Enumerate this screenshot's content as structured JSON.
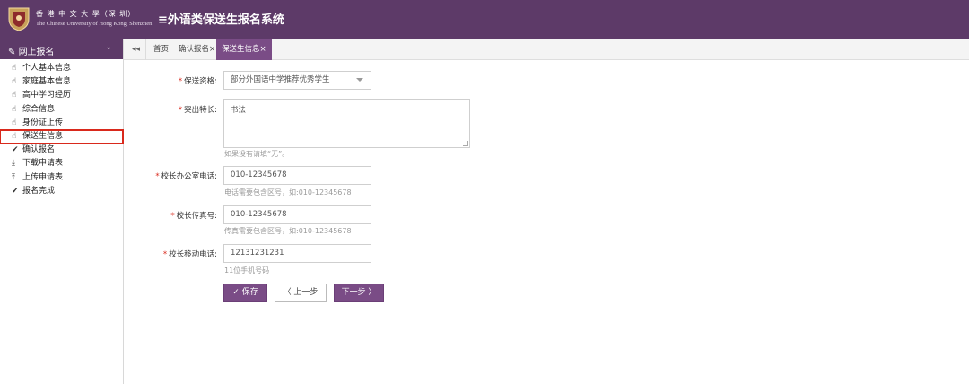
{
  "header": {
    "university_cn": "香 港 中 文 大 學（深 圳）",
    "university_en": "The Chinese University of Hong Kong, Shenzhen",
    "system_title": "≡外语类保送生报名系统",
    "brand_color": "#5d3a68"
  },
  "sidebar": {
    "section_title": "网上报名",
    "section_icon": "edit-icon",
    "items": [
      {
        "label": "个人基本信息",
        "icon": "hand-pointer-icon"
      },
      {
        "label": "家庭基本信息",
        "icon": "hand-pointer-icon"
      },
      {
        "label": "高中学习经历",
        "icon": "hand-pointer-icon"
      },
      {
        "label": "综合信息",
        "icon": "hand-pointer-icon"
      },
      {
        "label": "身份证上传",
        "icon": "hand-pointer-icon"
      },
      {
        "label": "保送生信息",
        "icon": "hand-pointer-icon",
        "active": true
      },
      {
        "label": "确认报名",
        "icon": "check-icon"
      },
      {
        "label": "下载申请表",
        "icon": "download-icon"
      },
      {
        "label": "上传申请表",
        "icon": "upload-icon"
      },
      {
        "label": "报名完成",
        "icon": "check-icon"
      }
    ]
  },
  "tabs": {
    "back_label": "◂◂",
    "items": [
      {
        "label": "首页"
      },
      {
        "label": "确认报名×"
      },
      {
        "label": "保送生信息×",
        "active": true
      }
    ]
  },
  "form": {
    "qualification": {
      "label": "保送资格:",
      "value": "部分外国语中学推荐优秀学生"
    },
    "specialty": {
      "label": "突出特长:",
      "value": "书法",
      "hint": "如果没有请填“无”。"
    },
    "office_phone": {
      "label": "校长办公室电话:",
      "value": "010-12345678",
      "hint": "电话需要包含区号，如:010-12345678"
    },
    "fax": {
      "label": "校长传真号:",
      "value": "010-12345678",
      "hint": "传真需要包含区号，如:010-12345678"
    },
    "mobile": {
      "label": "校长移动电话:",
      "value": "12131231231",
      "hint": "11位手机号码"
    },
    "required_mark": "*"
  },
  "buttons": {
    "save": "✓ 保存",
    "prev": "〈 上一步",
    "next": "下一步 〉"
  }
}
